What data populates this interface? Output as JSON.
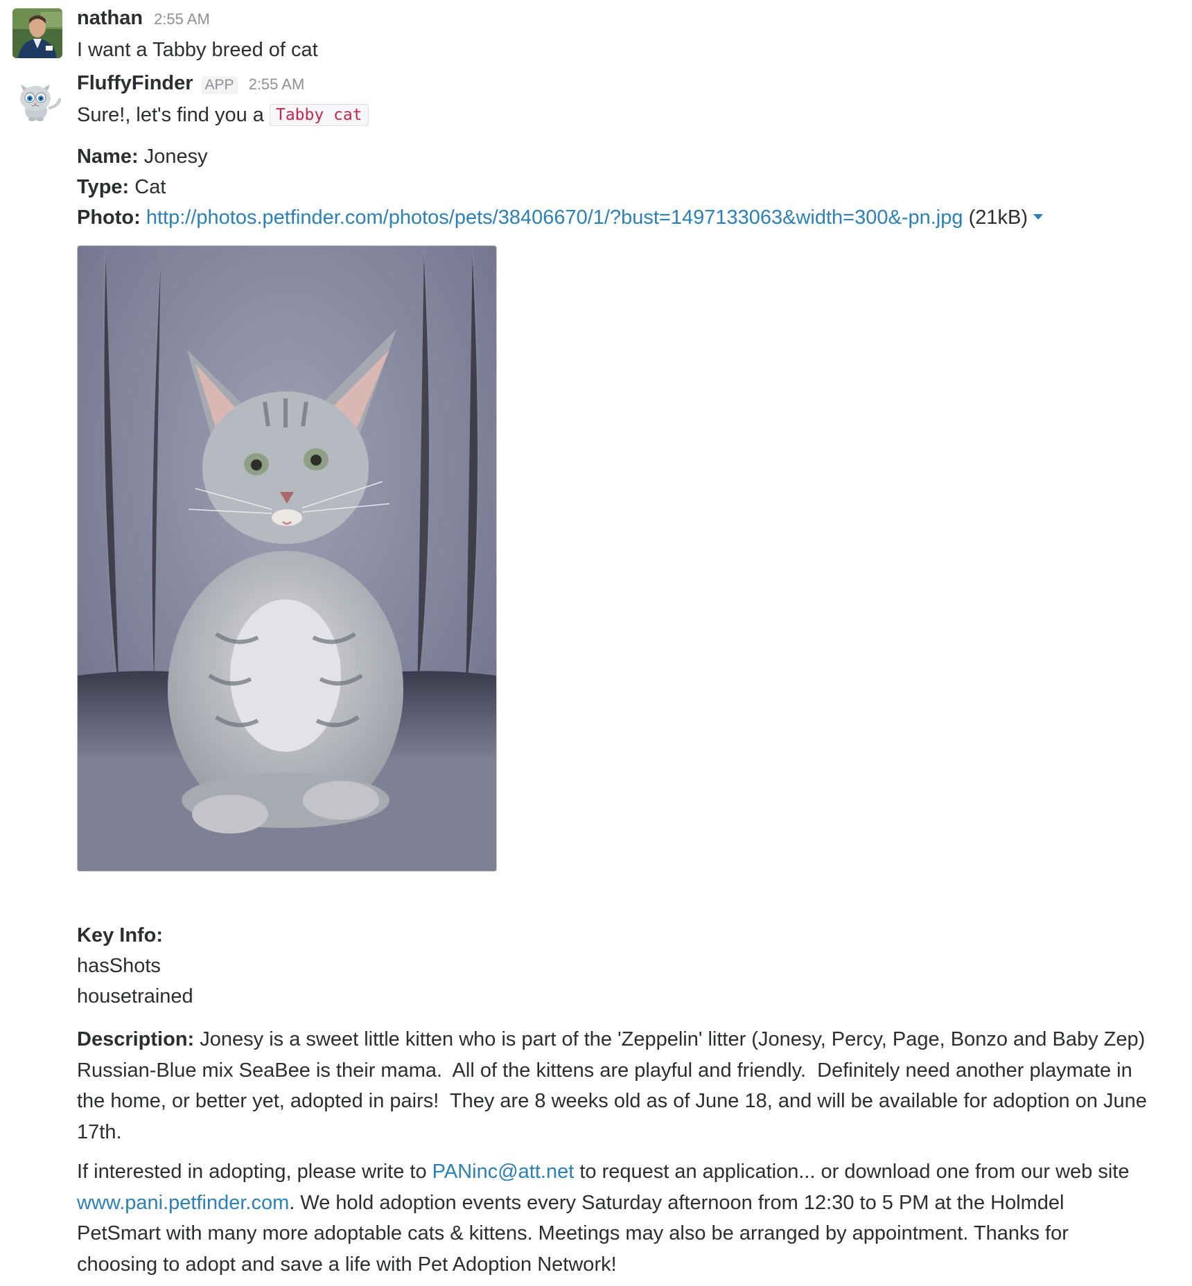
{
  "message_1": {
    "sender": "nathan",
    "time": "2:55 AM",
    "text": "I want a Tabby breed of cat"
  },
  "message_2": {
    "sender": "FluffyFinder",
    "app_badge": "APP",
    "time": "2:55 AM",
    "intro": "Sure!, let's find you a",
    "code": "Tabby cat",
    "name_label": "Name:",
    "name_value": "Jonesy",
    "type_label": "Type:",
    "type_value": "Cat",
    "photo_label": "Photo:",
    "photo_url": "http://photos.petfinder.com/photos/pets/38406670/1/?bust=1497133063&width=300&-pn.jpg",
    "photo_size": "(21kB)",
    "key_info_label": "Key Info:",
    "key_info_items": [
      "hasShots",
      "housetrained"
    ],
    "description_label": "Description:",
    "description_text": "Jonesy is a sweet little kitten who is part of the 'Zeppelin' litter (Jonesy, Percy, Page, Bonzo and Baby Zep)",
    "description_lines": [
      "Russian-Blue mix SeaBee is their mama.  All of the kittens are playful and friendly.  Definitely need another playmate in",
      "the home, or better yet, adopted in pairs!  They are 8 weeks old as of June 18, and will be available for adoption on June",
      "17th."
    ],
    "adopt_pre": "If interested in adopting, please write to",
    "adopt_email": "PANinc@att.net",
    "adopt_mid": "to request an application... or download one from our web site",
    "adopt_site": "www.pani.petfinder.com",
    "adopt_after_site": ". We hold adoption events every Saturday afternoon from 12:30 to 5 PM at the Holmdel",
    "adopt_lines": [
      "PetSmart with many more adoptable cats & kittens. Meetings may also be arranged by appointment. Thanks for",
      "choosing to adopt and save a life with Pet Adoption Network!"
    ]
  },
  "colors": {
    "link": "#2a80b9",
    "code_text": "#c7254e",
    "muted": "#8f9094"
  }
}
